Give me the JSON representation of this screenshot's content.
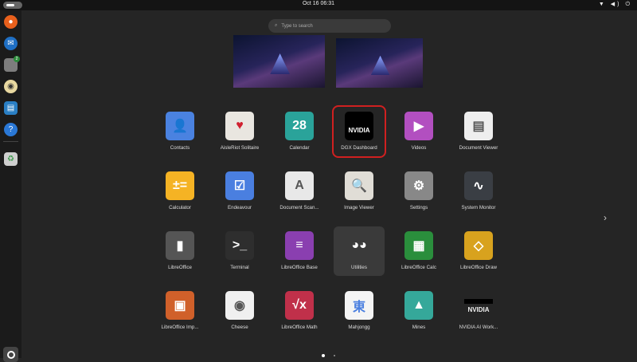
{
  "topbar": {
    "clock": "Oct 16  06:31",
    "tray": "▼ ◀) ⏻"
  },
  "search": {
    "placeholder": "Type to search"
  },
  "dock": [
    {
      "name": "firefox",
      "color": "#e8601c",
      "glyph": "●"
    },
    {
      "name": "thunderbird",
      "color": "#1f6fc4",
      "glyph": "✉"
    },
    {
      "name": "files",
      "color": "#7d7d7d",
      "glyph": "",
      "badge": "2"
    },
    {
      "name": "rhythmbox",
      "color": "#e8d8a0",
      "glyph": "◉"
    },
    {
      "name": "libreoffice-writer",
      "color": "#2a7fc4",
      "glyph": "▤"
    },
    {
      "name": "help",
      "color": "#2a78d6",
      "glyph": "?"
    },
    {
      "name": "trash",
      "color": "#cfcfcf",
      "glyph": "♻"
    }
  ],
  "apps": [
    {
      "label": "Contacts",
      "color": "#4a82e0",
      "glyph": "👤"
    },
    {
      "label": "AisleRiot Solitaire",
      "color": "#e9e6e0",
      "glyph": "♥"
    },
    {
      "label": "Calendar",
      "color": "#2aa39a",
      "glyph": "28"
    },
    {
      "label": "DGX Dashboard",
      "color": "#000000",
      "glyph": "NVIDIA",
      "selected": true
    },
    {
      "label": "Videos",
      "color": "#b24fc0",
      "glyph": "▶"
    },
    {
      "label": "Document Viewer",
      "color": "#eeeeee",
      "glyph": "▤"
    },
    {
      "label": "Calculator",
      "color": "#f5b324",
      "glyph": "±="
    },
    {
      "label": "Endeavour",
      "color": "#4a7fe0",
      "glyph": "☑"
    },
    {
      "label": "Document Scan...",
      "color": "#e8e8e8",
      "glyph": "A"
    },
    {
      "label": "Image Viewer",
      "color": "#e0ddd6",
      "glyph": "🔍"
    },
    {
      "label": "Settings",
      "color": "#888888",
      "glyph": "⚙"
    },
    {
      "label": "System Monitor",
      "color": "#3a3e44",
      "glyph": "∿"
    },
    {
      "label": "LibreOffice",
      "color": "#555555",
      "glyph": "▮"
    },
    {
      "label": "Terminal",
      "color": "#2e2e2e",
      "glyph": ">_"
    },
    {
      "label": "LibreOffice Base",
      "color": "#8a3fb0",
      "glyph": "≡"
    },
    {
      "label": "Utilities",
      "color": "transparent",
      "glyph": "◕◕",
      "folder": true
    },
    {
      "label": "LibreOffice Calc",
      "color": "#2a8e3c",
      "glyph": "▦"
    },
    {
      "label": "LibreOffice Draw",
      "color": "#d8a21e",
      "glyph": "◇"
    },
    {
      "label": "LibreOffice Imp...",
      "color": "#d0602a",
      "glyph": "▣"
    },
    {
      "label": "Cheese",
      "color": "#f0f0f0",
      "glyph": "◉"
    },
    {
      "label": "LibreOffice Math",
      "color": "#c0304a",
      "glyph": "√x"
    },
    {
      "label": "Mahjongg",
      "color": "#f4f4f4",
      "glyph": "東"
    },
    {
      "label": "Mines",
      "color": "#35a89a",
      "glyph": "▲"
    },
    {
      "label": "NVIDIA AI Work...",
      "color": "transparent",
      "glyph": "NVIDIA"
    }
  ],
  "pagination": {
    "pages": 2,
    "current": 1
  }
}
